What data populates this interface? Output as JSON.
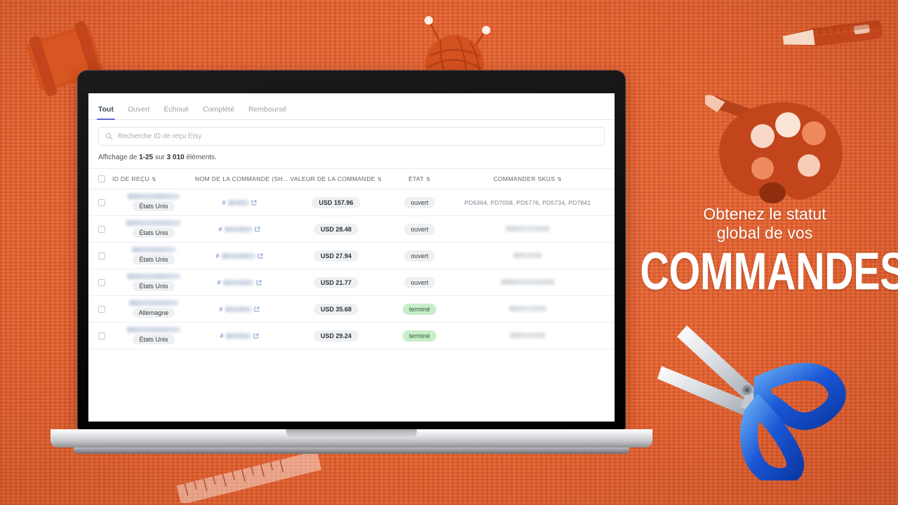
{
  "theme": {
    "background_color": "#E8602C",
    "accent_color": "#5b6ad0",
    "link_color": "#5b7ec4",
    "status_open_color": "#eef0f2",
    "status_done_color": "#c9edcb"
  },
  "promo": {
    "line1": "Obtenez le statut",
    "line2": "global de vos",
    "headline": "COMMANDES"
  },
  "decorations": [
    {
      "name": "thread-spool-icon"
    },
    {
      "name": "craft-knife-icon"
    },
    {
      "name": "yarn-ball-icon"
    },
    {
      "name": "paint-palette-icon"
    },
    {
      "name": "scissors-icon"
    },
    {
      "name": "ruler-icon"
    }
  ],
  "app": {
    "tabs": [
      {
        "label": "Tout",
        "active": true
      },
      {
        "label": "Ouvert",
        "active": false
      },
      {
        "label": "Échoué",
        "active": false
      },
      {
        "label": "Complété",
        "active": false
      },
      {
        "label": "Remboursé",
        "active": false
      }
    ],
    "search": {
      "icon": "search-icon",
      "placeholder": "Recherche ID de reçu Etsy",
      "value": ""
    },
    "count": {
      "prefix": "Affichage de ",
      "range": "1-25",
      "middle": " sur ",
      "total": "3 010",
      "suffix": " éléments."
    },
    "table": {
      "columns": [
        {
          "label": "",
          "sortable": false
        },
        {
          "label": "ID DE REÇU",
          "sortable": true
        },
        {
          "label": "NOM DE LA COMMANDE (SH...",
          "sortable": false
        },
        {
          "label": "VALEUR DE LA COMMANDE",
          "sortable": true
        },
        {
          "label": "ÉTAT",
          "sortable": true
        },
        {
          "label": "COMMANDER SKUS",
          "sortable": true
        }
      ],
      "sort_glyph": "⇅",
      "rows": [
        {
          "checked": false,
          "receipt_id": "",
          "receipt_id_redacted": true,
          "country": "États Unis",
          "order_name": "#7…3",
          "order_name_redacted": true,
          "order_value": "USD 157.96",
          "state": "ouvert",
          "state_type": "open",
          "skus": "PD6364, PD7058, PD5776, PD5734, PD7841",
          "skus_redacted": false
        },
        {
          "checked": false,
          "receipt_id": "",
          "receipt_id_redacted": true,
          "country": "États Unis",
          "order_name": "2",
          "order_name_redacted": true,
          "order_value": "USD 28.48",
          "state": "ouvert",
          "state_type": "open",
          "skus": "3",
          "skus_redacted": true
        },
        {
          "checked": false,
          "receipt_id": "",
          "receipt_id_redacted": true,
          "country": "États Unis",
          "order_name": "",
          "order_name_redacted": true,
          "order_value": "USD 27.94",
          "state": "ouvert",
          "state_type": "open",
          "skus": "",
          "skus_redacted": true
        },
        {
          "checked": false,
          "receipt_id": "",
          "receipt_id_redacted": true,
          "country": "États Unis",
          "order_name": "",
          "order_name_redacted": true,
          "order_value": "USD 21.77",
          "state": "ouvert",
          "state_type": "open",
          "skus": "",
          "skus_redacted": true
        },
        {
          "checked": false,
          "receipt_id": "",
          "receipt_id_redacted": true,
          "country": "Allemagne",
          "order_name": "",
          "order_name_redacted": true,
          "order_value": "USD 35.68",
          "state": "terminé",
          "state_type": "done",
          "skus": "",
          "skus_redacted": true
        },
        {
          "checked": false,
          "receipt_id": "",
          "receipt_id_redacted": true,
          "country": "États Unis",
          "order_name": "",
          "order_name_redacted": true,
          "order_value": "USD 29.24",
          "state": "terminé",
          "state_type": "done",
          "skus": "",
          "skus_redacted": true
        }
      ]
    }
  }
}
